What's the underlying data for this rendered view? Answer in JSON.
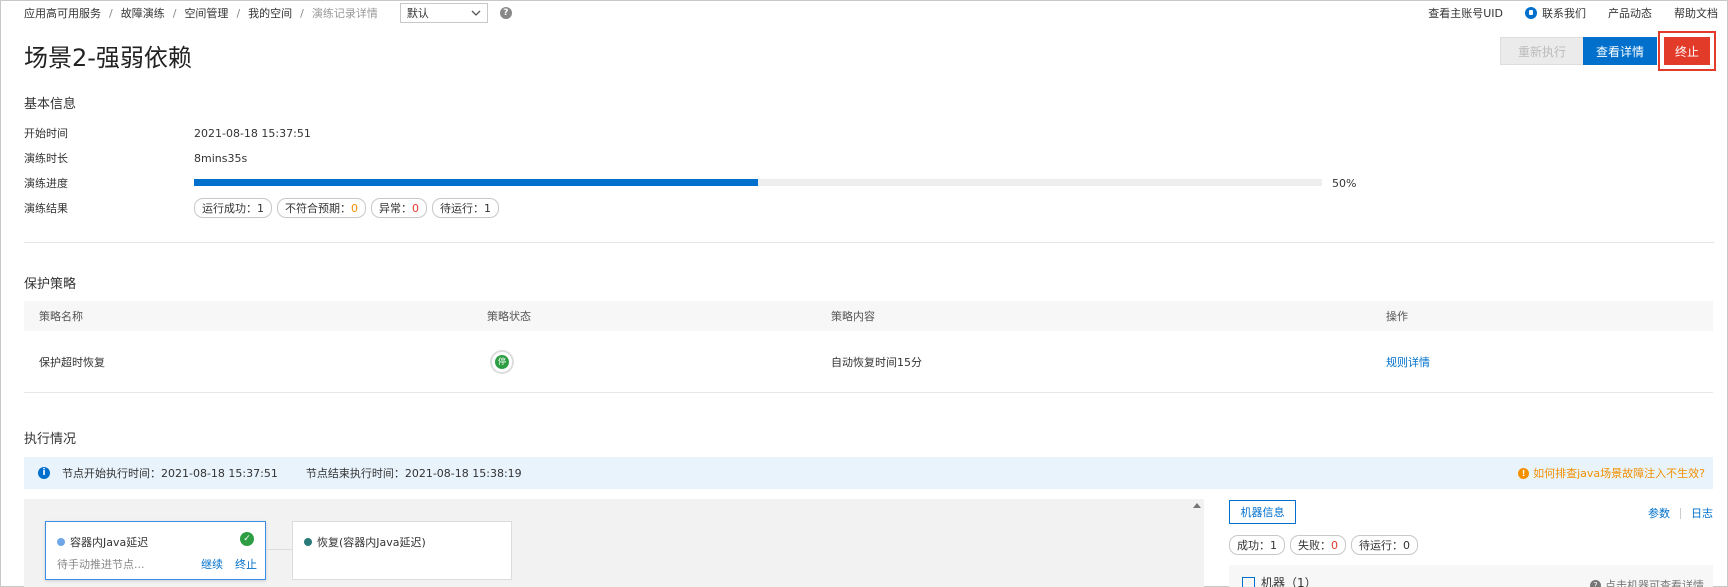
{
  "breadcrumbs": [
    "应用高可用服务",
    "故障演练",
    "空间管理",
    "我的空间",
    "演练记录详情"
  ],
  "select": {
    "value": "默认"
  },
  "top_links": {
    "uid": "查看主账号UID",
    "contact": "联系我们",
    "news": "产品动态",
    "docs": "帮助文档"
  },
  "page": {
    "title": "场景2-强弱依赖"
  },
  "actions": {
    "rerun": "重新执行",
    "view_detail": "查看详情",
    "stop": "终止"
  },
  "basic_info": {
    "title": "基本信息",
    "start_label": "开始时间",
    "start_value": "2021-08-18 15:37:51",
    "duration_label": "演练时长",
    "duration_value": "8mins35s",
    "progress_label": "演练进度",
    "progress_value": "50%",
    "progress_fraction": 0.5,
    "result_label": "演练结果",
    "results": [
      {
        "label": "运行成功：",
        "value": "1"
      },
      {
        "label": "不符合预期：",
        "value": "0"
      },
      {
        "label": "异常：",
        "value": "0"
      },
      {
        "label": "待运行：",
        "value": "1"
      }
    ]
  },
  "policy": {
    "title": "保护策略",
    "headers": [
      "策略名称",
      "策略状态",
      "策略内容",
      "操作"
    ],
    "row": {
      "name": "保护超时恢复",
      "status_badge": "停",
      "content": "自动恢复时间15分",
      "action": "规则详情"
    }
  },
  "execution": {
    "title": "执行情况",
    "node_start": "节点开始执行时间：2021-08-18 15:37:51",
    "node_end": "节点结束执行时间：2021-08-18 15:38:19",
    "tip": "如何排查java场景故障注入不生效?",
    "node1": {
      "name": "容器内Java延迟",
      "status": "待手动推进节点...",
      "continue": "继续",
      "stop": "终止"
    },
    "node2": {
      "name": "恢复(容器内Java延迟)"
    },
    "machine_info": "机器信息",
    "params": "参数",
    "log": "日志",
    "machine_results": [
      {
        "label": "成功：",
        "value": "1"
      },
      {
        "label": "失败：",
        "value": "0"
      },
      {
        "label": "待运行：",
        "value": "0"
      }
    ],
    "machine_title": "机器（1）",
    "click_tip": "点击机器可查看详情"
  },
  "colors": {
    "primary": "#0070cc",
    "danger": "#e23b2a",
    "success": "#2e9e44",
    "warning": "#f29000"
  }
}
